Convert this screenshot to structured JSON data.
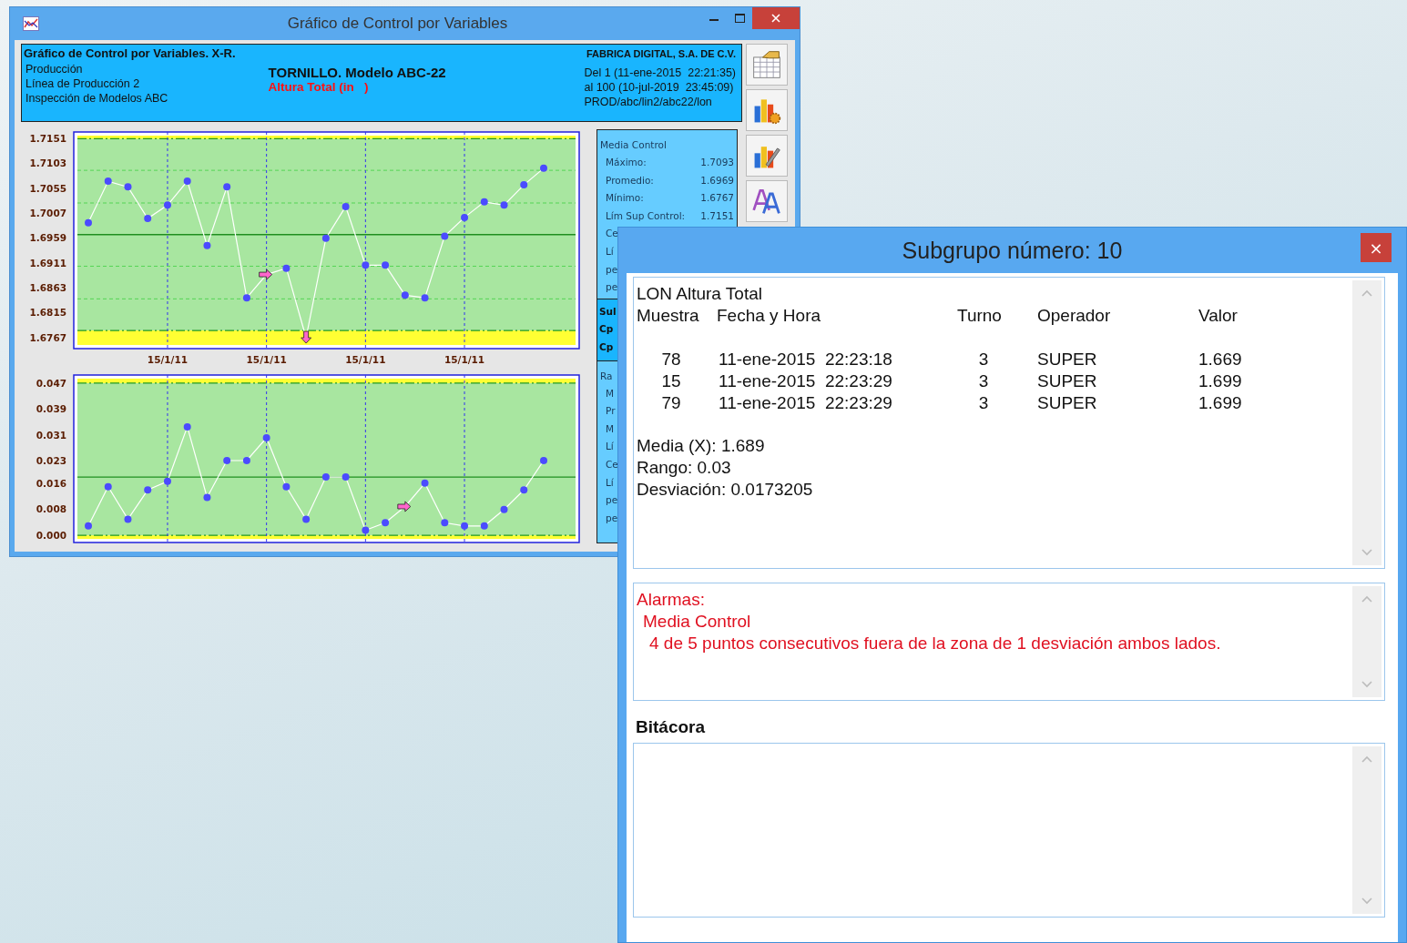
{
  "main_window": {
    "title": "Gráfico de Control por Variables"
  },
  "header": {
    "chart_title": "Gráfico de Control por Variables. X-R.",
    "lines": [
      "Producción",
      "Línea de Producción 2",
      "Inspección de Modelos ABC"
    ],
    "product": "TORNILLO. Modelo ABC-22",
    "characteristic": "Altura Total (in   )",
    "company": "FABRICA DIGITAL, S.A. DE C.V.",
    "range_lines": [
      "Del 1 (11-ene-2015  22:21:35)",
      "al 100 (10-jul-2019  23:45:09)",
      "PROD/abc/lin2/abc22/lon"
    ]
  },
  "mean_chart": {
    "chart_data": {
      "type": "line",
      "series": [
        {
          "marker": "circle",
          "values": [
            1.6989,
            1.7069,
            1.7058,
            1.6997,
            1.7023,
            1.7069,
            1.6945,
            1.7058,
            1.6844,
            1.6889,
            1.6901,
            1.6767,
            1.6959,
            1.702,
            1.6907,
            1.6907,
            1.6849,
            1.6844,
            1.6963,
            1.6999,
            1.7029,
            1.7023,
            1.7062,
            1.7094
          ]
        }
      ],
      "categories": [
        null,
        null,
        null,
        null,
        "15/1/11",
        null,
        null,
        null,
        null,
        "15/1/11",
        null,
        null,
        null,
        null,
        "15/1/11",
        null,
        null,
        null,
        null,
        "15/1/11",
        null,
        null,
        null,
        null
      ],
      "ylim": [
        1.6746,
        1.7164
      ],
      "yticks": [
        {
          "value": 1.7151,
          "label": "1.7151"
        },
        {
          "value": 1.7103,
          "label": "1.7103"
        },
        {
          "value": 1.7055,
          "label": "1.7055"
        },
        {
          "value": 1.7007,
          "label": "1.7007"
        },
        {
          "value": 1.6959,
          "label": "1.6959"
        },
        {
          "value": 1.6911,
          "label": "1.6911"
        },
        {
          "value": 1.6863,
          "label": "1.6863"
        },
        {
          "value": 1.6815,
          "label": "1.6815"
        },
        {
          "value": 1.6767,
          "label": "1.6767"
        }
      ],
      "grid": true,
      "ref_lines": [
        {
          "axis": "y",
          "value": 1.7151
        },
        {
          "axis": "y",
          "value": 1.6781
        },
        {
          "axis": "y",
          "value": 1.6966
        },
        {
          "axis": "y",
          "value": 1.709
        },
        {
          "axis": "y",
          "value": 1.7027
        },
        {
          "axis": "y",
          "value": 1.6905
        },
        {
          "axis": "y",
          "value": 1.6842
        }
      ],
      "bands": [
        {
          "axis": "y",
          "from": 1.7151,
          "to": 1.7157
        },
        {
          "axis": "y",
          "from": 1.6753,
          "to": 1.6781
        }
      ]
    },
    "points": [
      {
        "kind": "dot"
      },
      {
        "kind": "dot"
      },
      {
        "kind": "dot"
      },
      {
        "kind": "dot"
      },
      {
        "kind": "dot"
      },
      {
        "kind": "dot"
      },
      {
        "kind": "dot"
      },
      {
        "kind": "dot"
      },
      {
        "kind": "dot"
      },
      {
        "kind": "arrow_right"
      },
      {
        "kind": "dot"
      },
      {
        "kind": "arrow_down"
      },
      {
        "kind": "dot"
      },
      {
        "kind": "dot"
      },
      {
        "kind": "dot"
      },
      {
        "kind": "dot"
      },
      {
        "kind": "dot"
      },
      {
        "kind": "dot"
      },
      {
        "kind": "dot"
      },
      {
        "kind": "dot"
      },
      {
        "kind": "dot"
      },
      {
        "kind": "dot"
      },
      {
        "kind": "dot"
      },
      {
        "kind": "dot"
      }
    ]
  },
  "range_chart": {
    "chart_data": {
      "type": "line",
      "categories": [
        null,
        null,
        null,
        null,
        null,
        null,
        null,
        null,
        null,
        null,
        null,
        null,
        null,
        null,
        null,
        null,
        null,
        null,
        null,
        null,
        null,
        null,
        null,
        null
      ],
      "grid": true,
      "series": [
        {
          "marker": "circle",
          "values": [
            0.0029,
            0.015,
            0.005,
            0.014,
            0.0167,
            0.0335,
            0.0117,
            0.0231,
            0.0231,
            0.0301,
            0.015,
            0.005,
            0.018,
            0.018,
            0.0016,
            0.0039,
            0.0089,
            0.0161,
            0.0039,
            0.0029,
            0.0029,
            0.008,
            0.014,
            0.0231
          ]
        }
      ],
      "ylim": [
        -0.0022,
        0.0495
      ],
      "yticks": [
        {
          "value": 0.047,
          "label": "0.047"
        },
        {
          "value": 0.039,
          "label": "0.039"
        },
        {
          "value": 0.031,
          "label": "0.031"
        },
        {
          "value": 0.023,
          "label": "0.023"
        },
        {
          "value": 0.016,
          "label": "0.016"
        },
        {
          "value": 0.008,
          "label": "0.008"
        },
        {
          "value": 0,
          "label": "0.000"
        }
      ],
      "ref_lines": [
        {
          "axis": "y",
          "value": 0.047
        },
        {
          "axis": "y",
          "value": 0
        },
        {
          "axis": "y",
          "value": 0.018
        }
      ],
      "bands": [
        {
          "axis": "y",
          "from": 0.047,
          "to": 0.0484
        },
        {
          "axis": "y",
          "from": -0.0011,
          "to": 0
        }
      ]
    },
    "points": [
      {
        "kind": "dot"
      },
      {
        "kind": "dot"
      },
      {
        "kind": "dot"
      },
      {
        "kind": "dot"
      },
      {
        "kind": "dot"
      },
      {
        "kind": "dot"
      },
      {
        "kind": "dot"
      },
      {
        "kind": "dot"
      },
      {
        "kind": "dot"
      },
      {
        "kind": "dot"
      },
      {
        "kind": "dot"
      },
      {
        "kind": "dot"
      },
      {
        "kind": "dot"
      },
      {
        "kind": "dot"
      },
      {
        "kind": "dot"
      },
      {
        "kind": "dot"
      },
      {
        "kind": "arrow_right"
      },
      {
        "kind": "dot"
      },
      {
        "kind": "dot"
      },
      {
        "kind": "dot"
      },
      {
        "kind": "dot"
      },
      {
        "kind": "dot"
      },
      {
        "kind": "dot"
      },
      {
        "kind": "dot"
      }
    ]
  },
  "stats_panel": {
    "sections": [
      {
        "kind": "plain",
        "title": "Media Control",
        "rows": [
          {
            "label": "Máximo:",
            "value": "1.7093"
          },
          {
            "label": "Promedio:",
            "value": "1.6969"
          },
          {
            "label": "Mínimo:",
            "value": "1.6767"
          },
          {
            "label": "Lím Sup Control:",
            "value": "1.7151"
          },
          {
            "label": "Ce"
          },
          {
            "label": "Lí"
          },
          {
            "label": "pe"
          },
          {
            "label": "pe"
          }
        ]
      },
      {
        "kind": "highlight",
        "rows": [
          {
            "label": "Sul"
          },
          {
            "label": "Cp"
          },
          {
            "label": "Cp"
          }
        ]
      },
      {
        "kind": "plain",
        "title": "Ra",
        "rows": [
          {
            "label": "M"
          },
          {
            "label": "Pr"
          },
          {
            "label": "M"
          },
          {
            "label": "Lí"
          },
          {
            "label": "Ce"
          },
          {
            "label": "Lí"
          },
          {
            "label": "pe"
          },
          {
            "label": "pe"
          }
        ]
      }
    ]
  },
  "dialog": {
    "title": "Subgrupo número: 10",
    "close": "×",
    "variable": "LON Altura Total",
    "columns": [
      "Muestra",
      "Fecha y Hora",
      "Turno",
      "Operador",
      "Valor"
    ],
    "samples": [
      {
        "sample": "78",
        "datetime": "11-ene-2015  22:23:18",
        "shift": "3",
        "operator": "SUPER",
        "value": "1.669"
      },
      {
        "sample": "15",
        "datetime": "11-ene-2015  22:23:29",
        "shift": "3",
        "operator": "SUPER",
        "value": "1.699"
      },
      {
        "sample": "79",
        "datetime": "11-ene-2015  22:23:29",
        "shift": "3",
        "operator": "SUPER",
        "value": "1.699"
      }
    ],
    "summary": [
      "Media (X): 1.689",
      "Rango: 0.03",
      "Desviación: 0.0173205"
    ],
    "alarms": {
      "title": "Alarmas:",
      "chart": "Media Control",
      "message": "4 de 5 puntos consecutivos fuera de la zona de 1 desviación ambos lados."
    },
    "log_label": "Bitácora"
  }
}
